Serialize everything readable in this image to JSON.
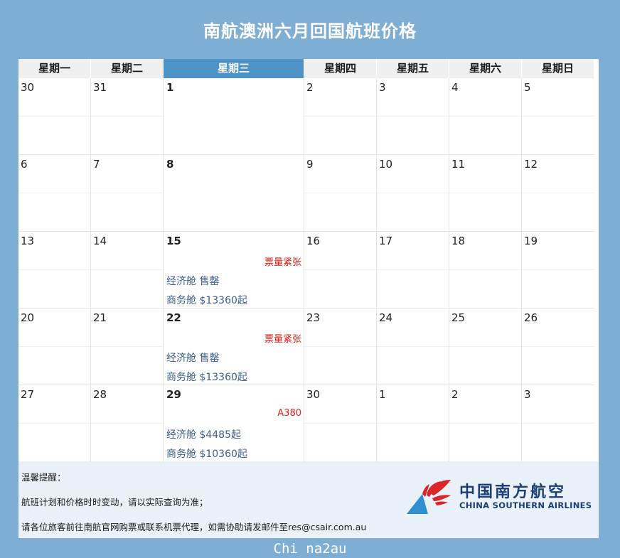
{
  "title": "南航澳洲六月回国航班价格",
  "weekdays": [
    "星期一",
    "星期二",
    "星期三",
    "星期四",
    "星期五",
    "星期六",
    "星期日"
  ],
  "weeks": [
    {
      "days": [
        "30",
        "31",
        "1",
        "2",
        "3",
        "4",
        "5"
      ],
      "note": "",
      "economy": "",
      "business": ""
    },
    {
      "days": [
        "6",
        "7",
        "8",
        "9",
        "10",
        "11",
        "12"
      ],
      "note": "",
      "economy": "",
      "business": ""
    },
    {
      "days": [
        "13",
        "14",
        "15",
        "16",
        "17",
        "18",
        "19"
      ],
      "note": "票量紧张",
      "economy": "经济舱 售罄",
      "business": "商务舱 $13360起"
    },
    {
      "days": [
        "20",
        "21",
        "22",
        "23",
        "24",
        "25",
        "26"
      ],
      "note": "票量紧张",
      "economy": "经济舱 售罄",
      "business": "商务舱 $13360起"
    },
    {
      "days": [
        "27",
        "28",
        "29",
        "30",
        "1",
        "2",
        "3"
      ],
      "note": "A380",
      "economy": "经济舱 $4485起",
      "business": "商务舱 $10360起"
    }
  ],
  "footer": {
    "reminder_title": "温馨提醒：",
    "line1": "航班计划和价格时时变动，请以实际查询为准；",
    "line2": "请各位旅客前往南航官网购票或联系机票代理，如需协助请发邮件至res@csair.com.au"
  },
  "logo": {
    "icon": "kapok-flower-icon",
    "cn": "中国南方航空",
    "en": "CHINA SOUTHERN AIRLINES"
  },
  "watermark": "Chi na2au",
  "colors": {
    "background": "#7eaed4",
    "header_highlight": "#4e93c7",
    "price_text": "#3a5f8e",
    "note_text": "#e0201c",
    "logo_blue": "#1b3e7a",
    "logo_red": "#d8262b",
    "logo_lightblue": "#2e8fd1"
  }
}
